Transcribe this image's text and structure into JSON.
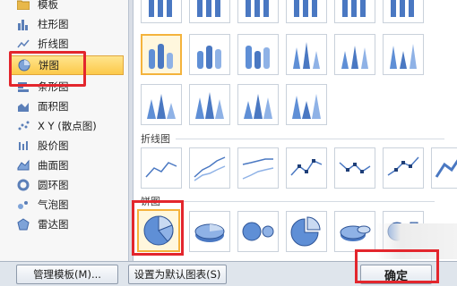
{
  "categories": [
    {
      "label": "模板",
      "icon": "folder-icon"
    },
    {
      "label": "柱形图",
      "icon": "column-chart-icon"
    },
    {
      "label": "折线图",
      "icon": "line-chart-icon"
    },
    {
      "label": "饼图",
      "icon": "pie-chart-icon",
      "selected": true
    },
    {
      "label": "条形图",
      "icon": "bar-chart-icon"
    },
    {
      "label": "面积图",
      "icon": "area-chart-icon"
    },
    {
      "label": "X Y (散点图)",
      "icon": "scatter-chart-icon"
    },
    {
      "label": "股价图",
      "icon": "stock-chart-icon"
    },
    {
      "label": "曲面图",
      "icon": "surface-chart-icon"
    },
    {
      "label": "圆环图",
      "icon": "doughnut-chart-icon"
    },
    {
      "label": "气泡图",
      "icon": "bubble-chart-icon"
    },
    {
      "label": "雷达图",
      "icon": "radar-chart-icon"
    }
  ],
  "gallery": {
    "line_section_label": "折线图",
    "pie_section_label": "饼图"
  },
  "buttons": {
    "manage_templates": "管理模板(M)...",
    "set_default": "设置为默认图表(S)",
    "ok": "确定"
  },
  "colors": {
    "selection_fill": "#fcc94a",
    "highlight_red": "#e3262d",
    "chart_blue": "#4a78c2"
  }
}
